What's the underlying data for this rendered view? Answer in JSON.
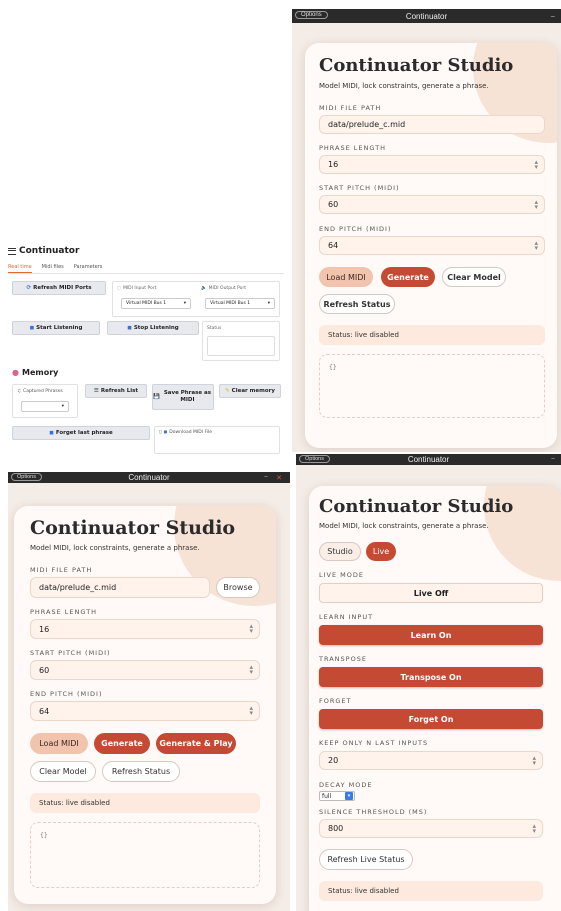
{
  "old_app": {
    "title": "Continuator",
    "tabs": [
      "Real time",
      "Midi files",
      "Parameters"
    ],
    "refresh_midi_ports": "Refresh MIDI Ports",
    "midi_input_port_label": "MIDI Input Port",
    "midi_input_port_value": "Virtual MIDI Bus 1",
    "midi_output_port_label": "MIDI Output Port",
    "midi_output_port_value": "Virtual MIDI Bus 1",
    "start_listening": "Start Listening",
    "stop_listening": "Stop Listening",
    "status_label": "Status",
    "memory_title": "Memory",
    "captured_phrases_label": "Captured Phrases",
    "refresh_list": "Refresh List",
    "save_phrase": "Save Phrase as MIDI",
    "clear_memory": "Clear memory",
    "forget_last_phrase": "Forget last phrase",
    "download_midi_file": "Download MIDI File"
  },
  "win_tr": {
    "options": "Options",
    "title": "Continuator",
    "heading": "Continuator Studio",
    "subtitle": "Model MIDI, lock constraints, generate a phrase.",
    "midi_file_path_label": "MIDI FILE PATH",
    "midi_file_path": "data/prelude_c.mid",
    "phrase_length_label": "PHRASE LENGTH",
    "phrase_length": "16",
    "start_pitch_label": "START PITCH (MIDI)",
    "start_pitch": "60",
    "end_pitch_label": "END PITCH (MIDI)",
    "end_pitch": "64",
    "load_midi": "Load MIDI",
    "generate": "Generate",
    "clear_model": "Clear Model",
    "refresh_status": "Refresh Status",
    "status": "Status: live disabled",
    "json": "{}"
  },
  "win_bl": {
    "options": "Options",
    "title": "Continuator",
    "heading": "Continuator Studio",
    "subtitle": "Model MIDI, lock constraints, generate a phrase.",
    "midi_file_path_label": "MIDI FILE PATH",
    "midi_file_path": "data/prelude_c.mid",
    "browse": "Browse",
    "phrase_length_label": "PHRASE LENGTH",
    "phrase_length": "16",
    "start_pitch_label": "START PITCH (MIDI)",
    "start_pitch": "60",
    "end_pitch_label": "END PITCH (MIDI)",
    "end_pitch": "64",
    "load_midi": "Load MIDI",
    "generate": "Generate",
    "generate_play": "Generate & Play",
    "clear_model": "Clear Model",
    "refresh_status": "Refresh Status",
    "status": "Status: live disabled",
    "json": "{}"
  },
  "win_br": {
    "options": "Options",
    "title": "Continuator",
    "heading": "Continuator Studio",
    "subtitle": "Model MIDI, lock constraints, generate a phrase.",
    "tab_studio": "Studio",
    "tab_live": "Live",
    "live_mode_label": "LIVE MODE",
    "live_off": "Live Off",
    "learn_input_label": "LEARN INPUT",
    "learn_on": "Learn On",
    "transpose_label": "TRANSPOSE",
    "transpose_on": "Transpose On",
    "forget_label": "FORGET",
    "forget_on": "Forget On",
    "keep_only_label": "KEEP ONLY N LAST INPUTS",
    "keep_only": "20",
    "decay_mode_label": "DECAY MODE",
    "decay_mode": "full",
    "silence_threshold_label": "SILENCE THRESHOLD (MS)",
    "silence_threshold": "800",
    "refresh_live_status": "Refresh Live Status",
    "status": "Status: live disabled"
  },
  "colors": {
    "accent": "#c44a34",
    "peach": "#f2c4ae",
    "card_bg": "#fffaf7",
    "window_bg": "#f4ece6"
  }
}
